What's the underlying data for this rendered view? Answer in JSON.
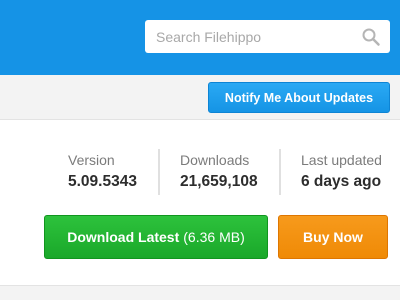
{
  "header": {
    "search": {
      "placeholder": "Search Filehippo",
      "value": "",
      "icon": "search-icon"
    },
    "brand_color": "#1593e6"
  },
  "subbar": {
    "notify_label": "Notify Me About Updates"
  },
  "stats": {
    "version": {
      "label": "Version",
      "value": "5.09.5343"
    },
    "downloads": {
      "label": "Downloads",
      "value": "21,659,108"
    },
    "last_updated": {
      "label": "Last updated",
      "value": "6 days ago"
    }
  },
  "actions": {
    "download_label": "Download Latest",
    "download_size": "(6.36 MB)",
    "buy_label": "Buy Now",
    "download_color": "#1fae2f",
    "buy_color": "#f38f0e"
  }
}
